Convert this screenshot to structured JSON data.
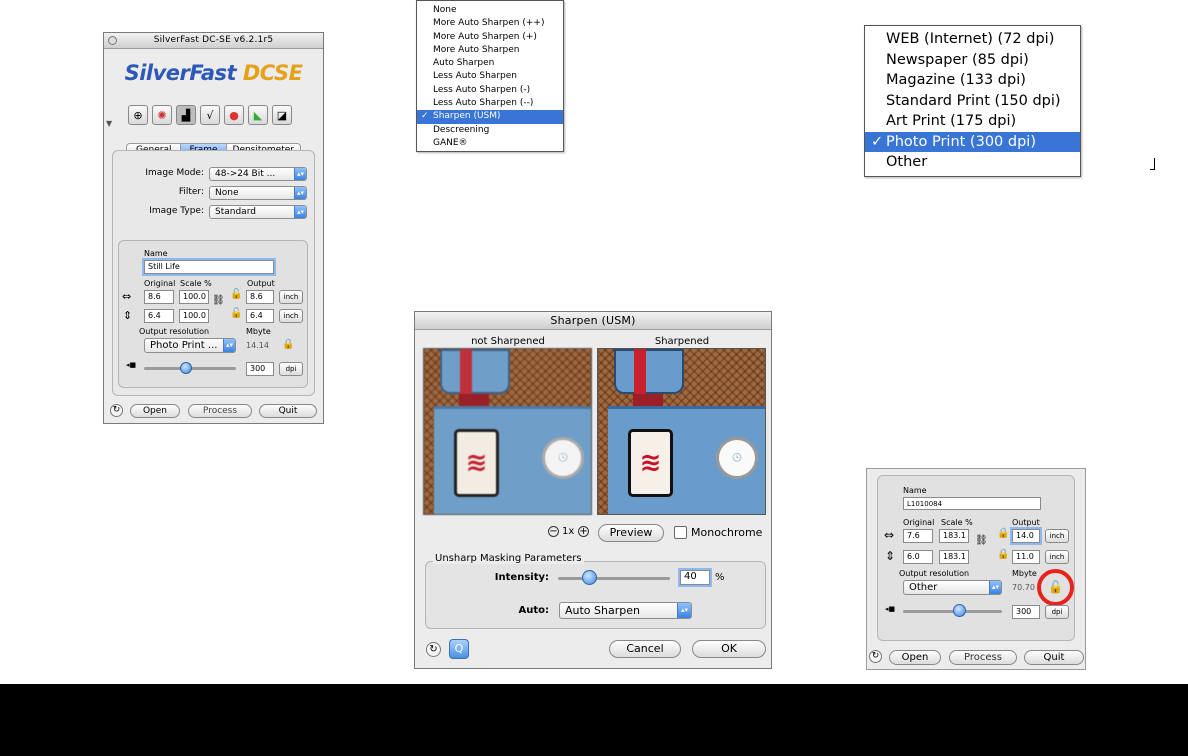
{
  "main_window": {
    "title": "SilverFast DC-SE v6.2.1r5",
    "logo_part1": "SilverFast ",
    "logo_part2": "DCSE",
    "tabs": [
      {
        "label": "General",
        "active": false
      },
      {
        "label": "Frame",
        "active": true
      },
      {
        "label": "Densitometer",
        "active": false
      }
    ],
    "image_mode_label": "Image Mode:",
    "image_mode_value": "48->24 Bit ...",
    "filter_label": "Filter:",
    "filter_value": "None",
    "image_type_label": "Image Type:",
    "image_type_value": "Standard",
    "name_label": "Name",
    "name_value": "Still Life",
    "original_label": "Original",
    "scale_label": "Scale %",
    "output_label": "Output",
    "width_original": "8.6",
    "width_scale": "100.0",
    "width_output": "8.6",
    "height_original": "6.4",
    "height_scale": "100.0",
    "height_output": "6.4",
    "unit": "inch",
    "output_res_label": "Output resolution",
    "output_res_value": "Photo Print ...",
    "mbyte_label": "Mbyte",
    "mbyte_value": "14.14",
    "dpi_value": "300",
    "dpi_unit": "dpi",
    "open_label": "Open",
    "process_label": "Process",
    "quit_label": "Quit"
  },
  "filter_menu": {
    "items": [
      "None",
      "More Auto Sharpen (++)",
      "More Auto Sharpen (+)",
      "More Auto Sharpen",
      "Auto Sharpen",
      "Less Auto Sharpen",
      "Less Auto Sharpen (-)",
      "Less Auto Sharpen (--)",
      "Sharpen (USM)",
      "Descreening",
      "GANE®"
    ],
    "selected_index": 8
  },
  "resolution_menu": {
    "items": [
      "WEB (Internet) (72 dpi)",
      "Newspaper (85 dpi)",
      "Magazine (133 dpi)",
      "Standard Print (150 dpi)",
      "Art Print (175 dpi)",
      "Photo Print (300 dpi)",
      "Other"
    ],
    "selected_index": 5
  },
  "usm_dialog": {
    "title": "Sharpen (USM)",
    "not_sharpened_label": "not Sharpened",
    "sharpened_label": "Sharpened",
    "zoom_label": "1x",
    "preview_label": "Preview",
    "monochrome_label": "Monochrome",
    "group_label": "Unsharp Masking Parameters",
    "intensity_label": "Intensity:",
    "intensity_value": "40",
    "intensity_unit": "%",
    "auto_label": "Auto:",
    "auto_value": "Auto Sharpen",
    "cancel_label": "Cancel",
    "ok_label": "OK",
    "intensity_fraction": 0.25
  },
  "frame_detail": {
    "name_label": "Name",
    "name_value": "L1010084",
    "original_label": "Original",
    "scale_label": "Scale %",
    "output_label": "Output",
    "width_original": "7.6",
    "width_scale": "183.1",
    "width_output": "14.0",
    "height_original": "6.0",
    "height_scale": "183.1",
    "height_output": "11.0",
    "unit": "inch",
    "output_res_label": "Output resolution",
    "output_res_value": "Other",
    "mbyte_label": "Mbyte",
    "mbyte_value": "70.70",
    "dpi_value": "300",
    "dpi_unit": "dpi",
    "open_label": "Open",
    "process_label": "Process",
    "quit_label": "Quit",
    "highlight_color": "#e8231b"
  },
  "colors": {
    "selection": "#3875d7",
    "footer_bar": "#000000"
  }
}
